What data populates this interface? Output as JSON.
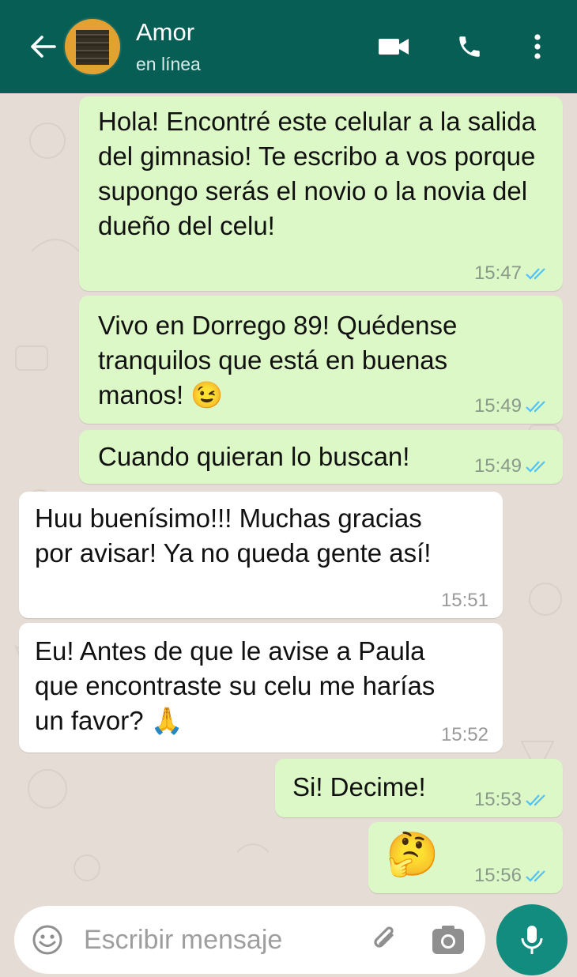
{
  "header": {
    "contact_name": "Amor",
    "status": "en línea"
  },
  "messages": [
    {
      "direction": "out",
      "text": "Hola! Encontré este celular a la salida del gimnasio! Te escribo a vos porque supongo serás el novio o la novia del dueño del celu!",
      "time": "15:47",
      "read": true
    },
    {
      "direction": "out",
      "text": "Vivo en Dorrego 89! Quédense tranquilos que está en buenas manos!",
      "emoji": "😉",
      "time": "15:49",
      "read": true
    },
    {
      "direction": "out",
      "text": "Cuando quieran lo buscan!",
      "time": "15:49",
      "read": true
    },
    {
      "direction": "in",
      "text": "Huu buenísimo!!! Muchas gracias por avisar! Ya no queda gente así!",
      "time": "15:51"
    },
    {
      "direction": "in",
      "text": "Eu! Antes de que le avise a Paula que encontraste su celu me harías un favor?",
      "emoji": "🙏",
      "time": "15:52"
    },
    {
      "direction": "out",
      "text": "Si! Decime!",
      "time": "15:53",
      "read": true
    },
    {
      "direction": "out",
      "text": "",
      "emoji": "🤔",
      "time": "15:56",
      "read": true
    }
  ],
  "input": {
    "placeholder": "Escribir mensaje"
  },
  "icons": {
    "back": "arrow-left-icon",
    "video": "video-camera-icon",
    "call": "phone-icon",
    "menu": "more-vert-icon",
    "emoji": "emoji-icon",
    "attach": "paperclip-icon",
    "camera": "camera-icon",
    "mic": "microphone-icon"
  },
  "colors": {
    "header": "#075e54",
    "outgoing_bubble": "#dcf8c6",
    "incoming_bubble": "#ffffff",
    "chat_background": "#e5ddd5",
    "read_ticks": "#4fc3f7",
    "mic_button": "#128c7e"
  }
}
